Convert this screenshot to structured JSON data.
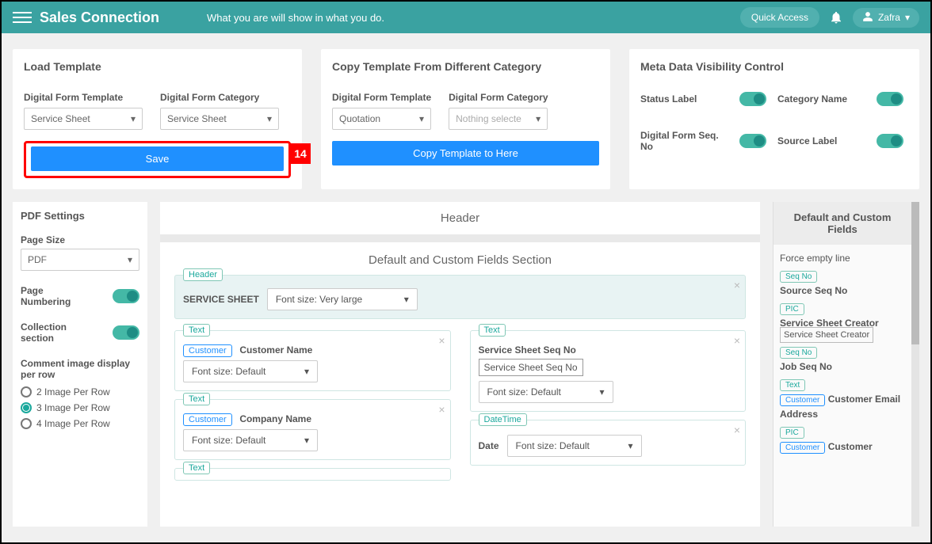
{
  "header": {
    "brand": "Sales Connection",
    "tagline": "What you are will show in what you do.",
    "quick_access": "Quick Access",
    "user_name": "Zafra"
  },
  "load_card": {
    "title": "Load Template",
    "template_label": "Digital Form Template",
    "template_value": "Service Sheet",
    "category_label": "Digital Form Category",
    "category_value": "Service Sheet",
    "save_btn": "Save",
    "step_tag": "14"
  },
  "copy_card": {
    "title": "Copy Template From Different Category",
    "template_label": "Digital Form Template",
    "template_value": "Quotation",
    "category_label": "Digital Form Category",
    "category_value": "Nothing selecte",
    "copy_btn": "Copy Template to Here"
  },
  "meta_card": {
    "title": "Meta Data Visibility Control",
    "opts": [
      "Status Label",
      "Category Name",
      "Digital Form Seq. No",
      "Source Label"
    ]
  },
  "pdf": {
    "title": "PDF Settings",
    "page_size_label": "Page Size",
    "page_size_value": "PDF",
    "page_numbering": "Page Numbering",
    "collection": "Collection section",
    "comment_image": "Comment image display per row",
    "radios": [
      "2 Image Per Row",
      "3 Image Per Row",
      "4 Image Per Row"
    ]
  },
  "builder": {
    "header": "Header",
    "section_title": "Default and Custom Fields Section",
    "header_block": {
      "pill": "Header",
      "label": "SERVICE SHEET",
      "font": "Font size: Very large"
    },
    "left_blocks": [
      {
        "pill": "Text",
        "sub": "Customer",
        "label": "Customer Name",
        "font": "Font size: Default"
      },
      {
        "pill": "Text",
        "sub": "Customer",
        "label": "Company Name",
        "font": "Font size: Default"
      },
      {
        "pill": "Text"
      }
    ],
    "right_blocks": [
      {
        "pill": "Text",
        "label": "Service Sheet Seq No",
        "boxed": "Service Sheet Seq No",
        "font": "Font size: Default"
      },
      {
        "pill": "DateTime",
        "label": "Date",
        "font": "Font size: Default"
      }
    ]
  },
  "palette": {
    "title": "Default and Custom Fields",
    "items": [
      {
        "text": "Force empty line"
      },
      {
        "pill": "Seq No",
        "text": "Source Seq No"
      },
      {
        "pill": "PIC",
        "boxed": "Service Sheet Creator",
        "label": "Service Sheet Creator"
      },
      {
        "pill": "Seq No",
        "text": "Job Seq No"
      },
      {
        "pill": "Text",
        "sub": "Customer",
        "text": "Customer Email Address"
      },
      {
        "pill": "PIC",
        "sub": "Customer",
        "text": "Customer"
      }
    ]
  }
}
